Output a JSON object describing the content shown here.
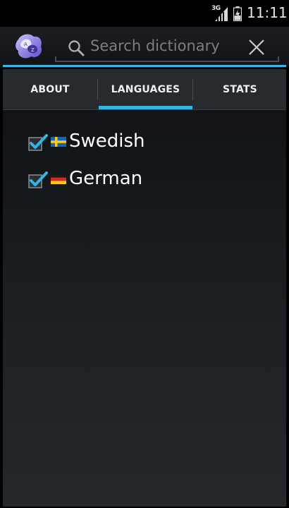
{
  "status_bar": {
    "network_type": "3G",
    "time": "11:11",
    "icons": [
      "signal-icon",
      "battery-charging-icon"
    ]
  },
  "action_bar": {
    "app_icon": "dictionary-app-icon",
    "search": {
      "placeholder": "Search dictionary",
      "value": ""
    },
    "accent_color": "#33b5e5"
  },
  "tabs": [
    {
      "label": "ABOUT",
      "selected": false
    },
    {
      "label": "LANGUAGES",
      "selected": true
    },
    {
      "label": "STATS",
      "selected": false
    }
  ],
  "languages": [
    {
      "name": "Swedish",
      "checked": true,
      "flag": "swedish-flag-icon"
    },
    {
      "name": "German",
      "checked": true,
      "flag": "german-flag-icon"
    }
  ]
}
